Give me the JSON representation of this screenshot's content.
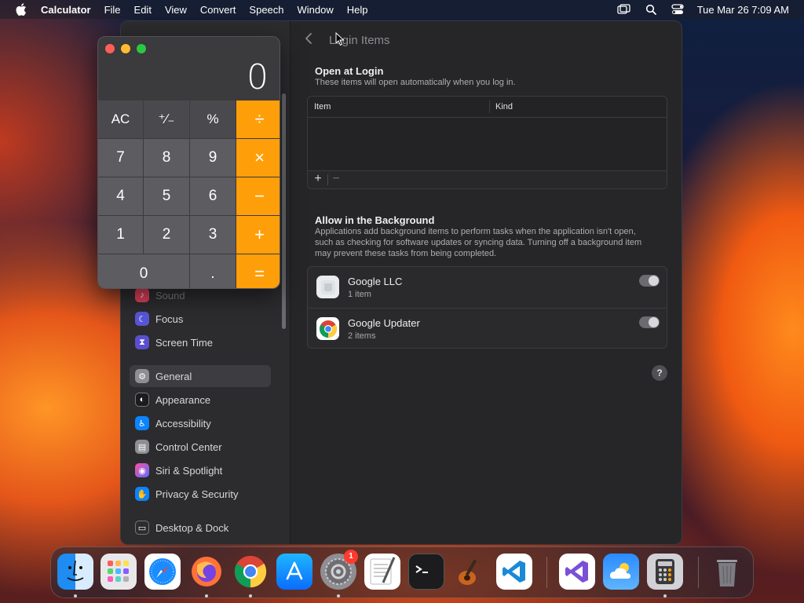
{
  "menubar": {
    "app_name": "Calculator",
    "items": [
      "File",
      "Edit",
      "View",
      "Convert",
      "Speech",
      "Window",
      "Help"
    ],
    "clock": "Tue Mar 26  7:09 AM",
    "status_icons": [
      "screen-mirroring-icon",
      "spotlight-search-icon",
      "control-center-icon"
    ]
  },
  "settings": {
    "title": "Login Items",
    "sidebar": {
      "items": [
        {
          "label": "Sound",
          "icon": "sound-icon",
          "color": "#e0405a"
        },
        {
          "label": "Focus",
          "icon": "moon-icon",
          "color": "#5856d6"
        },
        {
          "label": "Screen Time",
          "icon": "hourglass-icon",
          "color": "#5a4fcf"
        },
        {
          "label": "General",
          "icon": "gear-icon",
          "color": "#8e8e93"
        },
        {
          "label": "Appearance",
          "icon": "appearance-icon",
          "color": "#1c1c1e"
        },
        {
          "label": "Accessibility",
          "icon": "accessibility-icon",
          "color": "#0a84ff"
        },
        {
          "label": "Control Center",
          "icon": "control-center-icon",
          "color": "#8e8e93"
        },
        {
          "label": "Siri & Spotlight",
          "icon": "siri-icon",
          "color": "#c04fd0"
        },
        {
          "label": "Privacy & Security",
          "icon": "hand-icon",
          "color": "#0a84ff"
        },
        {
          "label": "Desktop & Dock",
          "icon": "dock-icon",
          "color": "#2c2c2e"
        }
      ]
    },
    "open_at_login": {
      "title": "Open at Login",
      "subtitle": "These items will open automatically when you log in.",
      "columns": [
        "Item",
        "Kind"
      ],
      "add_label": "+",
      "remove_label": "−"
    },
    "background": {
      "title": "Allow in the Background",
      "description": "Applications add background items to perform tasks when the application isn't open, such as checking for software updates or syncing data. Turning off a background item may prevent these tasks from being completed.",
      "items": [
        {
          "name": "Google LLC",
          "detail": "1 item",
          "enabled": true
        },
        {
          "name": "Google Updater",
          "detail": "2 items",
          "enabled": true
        }
      ]
    },
    "help_label": "?"
  },
  "calculator": {
    "display": "0",
    "keys": [
      "AC",
      "⁺∕₋",
      "%",
      "÷",
      "7",
      "8",
      "9",
      "×",
      "4",
      "5",
      "6",
      "−",
      "1",
      "2",
      "3",
      "+",
      "0",
      ".",
      "="
    ]
  },
  "dock": {
    "apps": [
      "Finder",
      "Launchpad",
      "Safari",
      "Firefox",
      "Google Chrome",
      "App Store",
      "System Settings",
      "TextEdit",
      "Terminal",
      "GarageBand",
      "Visual Studio Code",
      "Visual Studio",
      "Weather",
      "Calculator",
      "Trash"
    ],
    "system_settings_badge": "1"
  }
}
